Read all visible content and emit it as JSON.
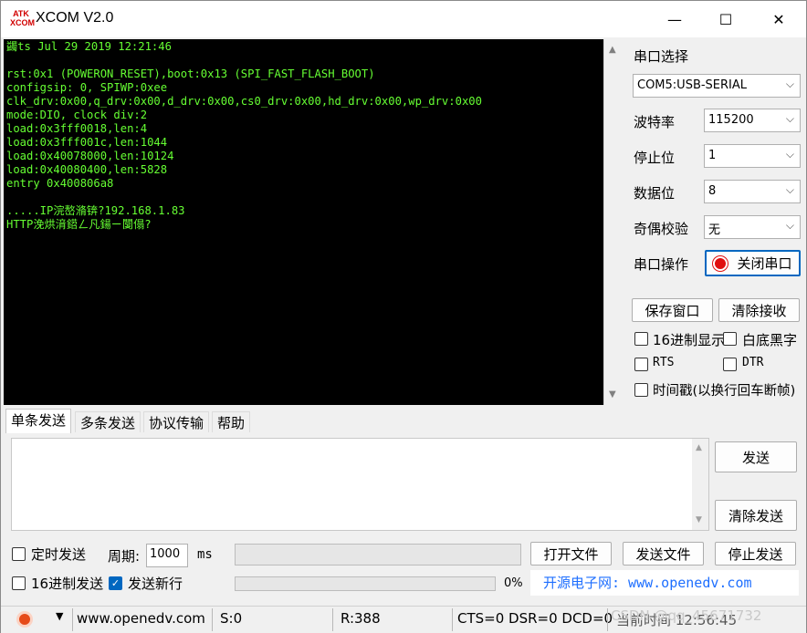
{
  "window": {
    "title": "XCOM V2.0",
    "logo_line1": "ATK",
    "logo_line2": "XCOM",
    "min_glyph": "—",
    "max_glyph": "☐",
    "close_glyph": "✕"
  },
  "terminal": {
    "lines": [
      "蠲ts Jul 29 2019 12:21:46",
      "",
      "rst:0x1 (POWERON_RESET),boot:0x13 (SPI_FAST_FLASH_BOOT)",
      "configsip: 0, SPIWP:0xee",
      "clk_drv:0x00,q_drv:0x00,d_drv:0x00,cs0_drv:0x00,hd_drv:0x00,wp_drv:0x00",
      "mode:DIO, clock div:2",
      "load:0x3fff0018,len:4",
      "load:0x3fff001c,len:1044",
      "load:0x40078000,len:10124",
      "load:0x40080400,len:5828",
      "entry 0x400806a8",
      "",
      ".....IP浣嶅潃锛?192.168.1.83",
      "HTTP浼烘湇鍣ㄥ凡鍚ㄧ闅傝?"
    ],
    "scroll_up": "▲",
    "scroll_down": "▼"
  },
  "serial": {
    "port_select_label": "串口选择",
    "port_value": "COM5:USB-SERIAL",
    "baud_label": "波特率",
    "baud_value": "115200",
    "stopbits_label": "停止位",
    "stopbits_value": "1",
    "databits_label": "数据位",
    "databits_value": "8",
    "parity_label": "奇偶校验",
    "parity_value": "无",
    "operation_label": "串口操作",
    "close_port_label": "关闭串口",
    "save_window_label": "保存窗口",
    "clear_receive_label": "清除接收",
    "hex_display_label": "16进制显示",
    "white_bg_label": "白底黑字",
    "rts_label": "RTS",
    "dtr_label": "DTR",
    "timestamp_label": "时间戳(以换行回车断帧)",
    "hex_display_checked": false,
    "white_bg_checked": false,
    "rts_checked": false,
    "dtr_checked": false,
    "timestamp_checked": false,
    "chevron": "⌵"
  },
  "tabs": [
    "单条发送",
    "多条发送",
    "协议传输",
    "帮助"
  ],
  "send": {
    "send_label": "发送",
    "clear_send_label": "清除发送",
    "timed_send_label": "定时发送",
    "period_label": "周期:",
    "period_value": "1000",
    "period_unit": "ms",
    "open_file_label": "打开文件",
    "send_file_label": "发送文件",
    "stop_send_label": "停止发送",
    "hex_send_label": "16进制发送",
    "send_newline_label": "发送新行",
    "timed_send_checked": false,
    "hex_send_checked": false,
    "send_newline_checked": true,
    "progress_percent": "0%",
    "progress_value": 0,
    "promo_text": "开源电子网: www.openedv.com"
  },
  "status": {
    "website": "www.openedv.com",
    "sent": "S:0",
    "received": "R:388",
    "line_status": "CTS=0 DSR=0 DCD=0",
    "current_time": "当前时间 12:56:45",
    "watermark": "CSDN @qq_45671732"
  },
  "colors": {
    "terminal_bg": "#000000",
    "terminal_fg": "#66ff33",
    "promo_fg": "#1e6fff",
    "close_btn_border": "#0067c0",
    "led_red": "#e01010"
  }
}
